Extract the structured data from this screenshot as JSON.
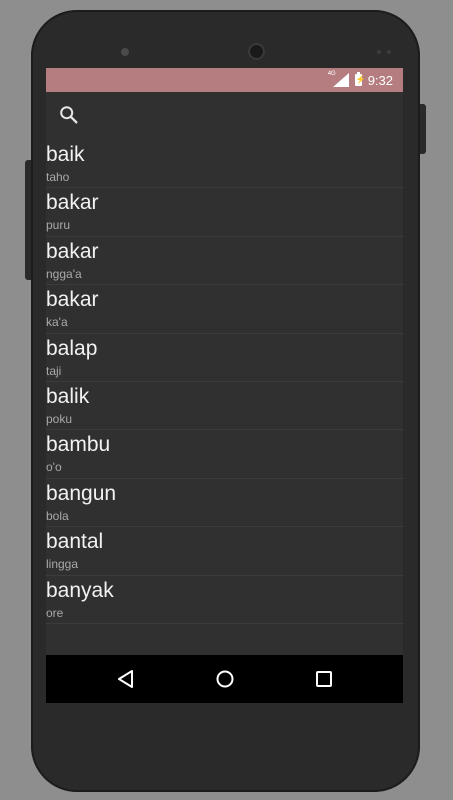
{
  "status_bar": {
    "network": "4G",
    "time": "9:32",
    "background_color": "#b57d7f"
  },
  "search": {
    "icon": "search-icon"
  },
  "entries": [
    {
      "word": "baik",
      "meaning": "taho"
    },
    {
      "word": "bakar",
      "meaning": "puru"
    },
    {
      "word": "bakar",
      "meaning": "ngga'a"
    },
    {
      "word": "bakar",
      "meaning": "ka'a"
    },
    {
      "word": "balap",
      "meaning": "taji"
    },
    {
      "word": "balik",
      "meaning": "poku"
    },
    {
      "word": "bambu",
      "meaning": "o'o"
    },
    {
      "word": "bangun",
      "meaning": "bola"
    },
    {
      "word": "bantal",
      "meaning": "lingga"
    },
    {
      "word": "banyak",
      "meaning": "ore"
    }
  ],
  "nav_bar": {
    "buttons": [
      "back-icon",
      "home-icon",
      "recents-icon"
    ]
  }
}
